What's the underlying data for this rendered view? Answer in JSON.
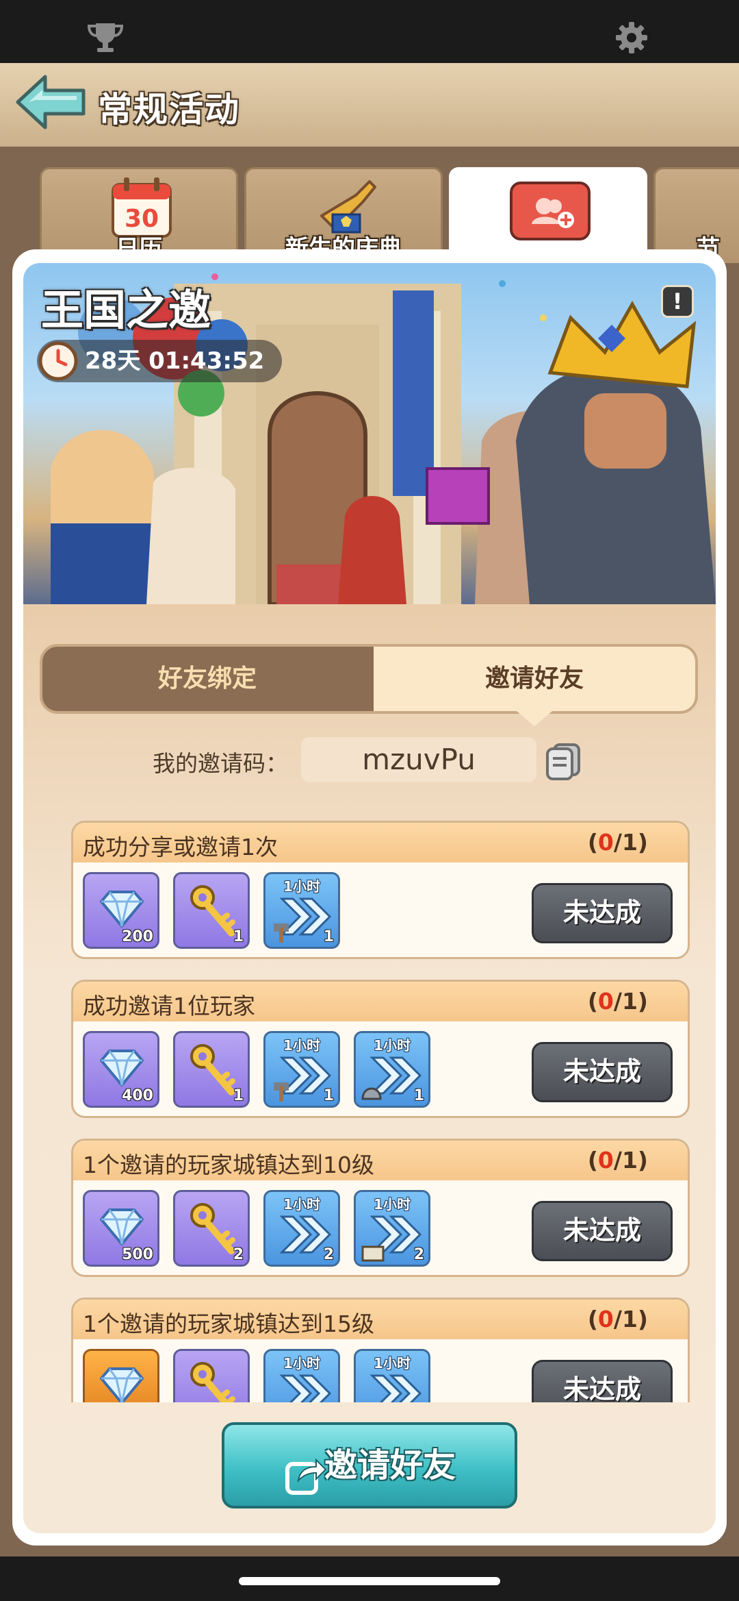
{
  "header": {
    "title": "常规活动"
  },
  "tabs": [
    {
      "label": "日历",
      "icon": "calendar-icon"
    },
    {
      "label": "新生的庆典",
      "icon": "trumpet-icon"
    },
    {
      "label": "",
      "icon": "invite-friend-icon",
      "active": true
    },
    {
      "label": "节",
      "icon": "partial-tab-icon"
    }
  ],
  "calendar_day": "30",
  "banner": {
    "title": "王国之邀",
    "timer": "28天 01:43:52",
    "info": "!"
  },
  "segment": {
    "left": "好友绑定",
    "right": "邀请好友"
  },
  "invite_code": {
    "label": "我的邀请码：",
    "value": "mzuvPu"
  },
  "tasks": [
    {
      "title": "成功分享或邀请1次",
      "progress_current": "0",
      "progress_total": "1",
      "status": "未达成",
      "rewards": [
        {
          "type": "gem",
          "count": "200",
          "tag": ""
        },
        {
          "type": "key",
          "count": "1",
          "tag": ""
        },
        {
          "type": "hammer-speedup",
          "count": "1",
          "tag": "1小时"
        }
      ]
    },
    {
      "title": "成功邀请1位玩家",
      "progress_current": "0",
      "progress_total": "1",
      "status": "未达成",
      "rewards": [
        {
          "type": "gem",
          "count": "400",
          "tag": ""
        },
        {
          "type": "key",
          "count": "1",
          "tag": ""
        },
        {
          "type": "hammer-speedup",
          "count": "1",
          "tag": "1小时"
        },
        {
          "type": "helmet-speedup",
          "count": "1",
          "tag": "1小时"
        }
      ]
    },
    {
      "title": "1个邀请的玩家城镇达到10级",
      "progress_current": "0",
      "progress_total": "1",
      "status": "未达成",
      "rewards": [
        {
          "type": "gem",
          "count": "500",
          "tag": ""
        },
        {
          "type": "key",
          "count": "2",
          "tag": ""
        },
        {
          "type": "speedup",
          "count": "2",
          "tag": "1小时"
        },
        {
          "type": "book-speedup",
          "count": "2",
          "tag": "1小时"
        }
      ]
    },
    {
      "title": "1个邀请的玩家城镇达到15级",
      "progress_current": "0",
      "progress_total": "1",
      "status": "未达成",
      "rewards": [
        {
          "type": "gem",
          "count": "",
          "tag": ""
        },
        {
          "type": "key",
          "count": "",
          "tag": ""
        },
        {
          "type": "speedup",
          "count": "",
          "tag": "1小时"
        },
        {
          "type": "book-speedup",
          "count": "",
          "tag": "1小时"
        }
      ]
    }
  ],
  "invite_button": {
    "label": "邀请好友"
  },
  "colors": {
    "accent_teal": "#3fc0c6",
    "progress_red": "#e0331c",
    "header_bg": "#e6d2b0"
  }
}
